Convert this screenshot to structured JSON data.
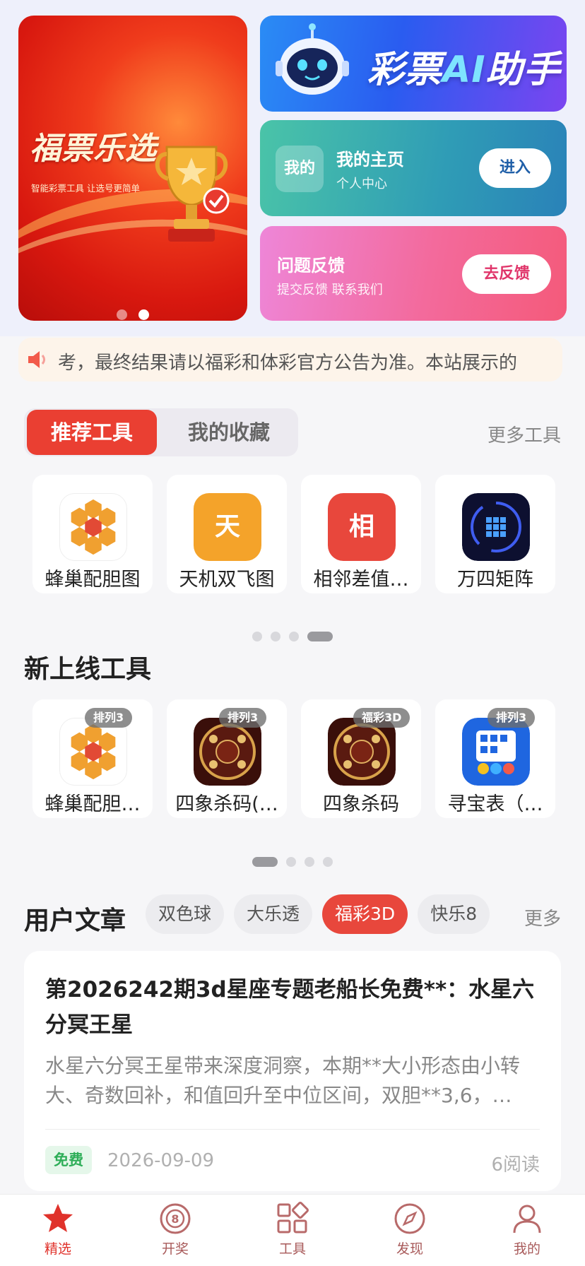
{
  "banner": {
    "title": "福票乐选",
    "subtitle": "智能彩票工具  让选号更简单"
  },
  "ai_card": {
    "title_a": "彩票",
    "title_ai": "AI",
    "title_b": "助手"
  },
  "home_card": {
    "tag": "我的",
    "title": "我的主页",
    "subtitle": "个人中心",
    "button": "进入"
  },
  "feedback_card": {
    "title": "问题反馈",
    "subtitle": "提交反馈 联系我们",
    "button": "去反馈"
  },
  "notice": {
    "text": "考，最终结果请以福彩和体彩官方公告为准。本站展示的"
  },
  "tool_tabs": {
    "recommended": "推荐工具",
    "favorites": "我的收藏",
    "more": "更多工具"
  },
  "recommended_tools": [
    {
      "label": "蜂巢配胆图",
      "icon": "honeycomb-icon"
    },
    {
      "label": "天机双飞图",
      "icon": "text-tian-icon",
      "glyph": "天",
      "color": "#f4a32a"
    },
    {
      "label": "相邻差值…",
      "icon": "text-xiang-icon",
      "glyph": "相",
      "color": "#e8473c"
    },
    {
      "label": "万四矩阵",
      "icon": "matrix-icon"
    }
  ],
  "new_tools_title": "新上线工具",
  "new_tools": [
    {
      "label": "蜂巢配胆…",
      "badge": "排列3",
      "icon": "honeycomb-icon"
    },
    {
      "label": "四象杀码(…",
      "badge": "排列3",
      "icon": "four-symbols-kill-icon"
    },
    {
      "label": "四象杀码",
      "badge": "福彩3D",
      "icon": "four-symbols-kill-icon"
    },
    {
      "label": "寻宝表（…",
      "badge": "排列3",
      "icon": "treasure-chart-icon"
    }
  ],
  "articles": {
    "title": "用户文章",
    "tabs": [
      "双色球",
      "大乐透",
      "福彩3D",
      "快乐8"
    ],
    "active_tab": "福彩3D",
    "more": "更多",
    "item": {
      "headline": "第2026242期3d星座专题老船长免费**：水星六分冥王星",
      "summary": "水星六分冥王星带来深度洞察，本期**大小形态由小转大、奇数回补，和值回升至中位区间，双胆**3,6，…",
      "tag": "免费",
      "date": "2026-09-09",
      "reads": "6阅读"
    }
  },
  "tabbar": [
    {
      "label": "精选",
      "icon": "star-icon",
      "active": true
    },
    {
      "label": "开奖",
      "icon": "lottery-ball-icon"
    },
    {
      "label": "工具",
      "icon": "grid-icon"
    },
    {
      "label": "发现",
      "icon": "compass-icon"
    },
    {
      "label": "我的",
      "icon": "user-icon"
    }
  ],
  "colors": {
    "accent": "#e8473c",
    "tab_active": "#e0322b"
  }
}
